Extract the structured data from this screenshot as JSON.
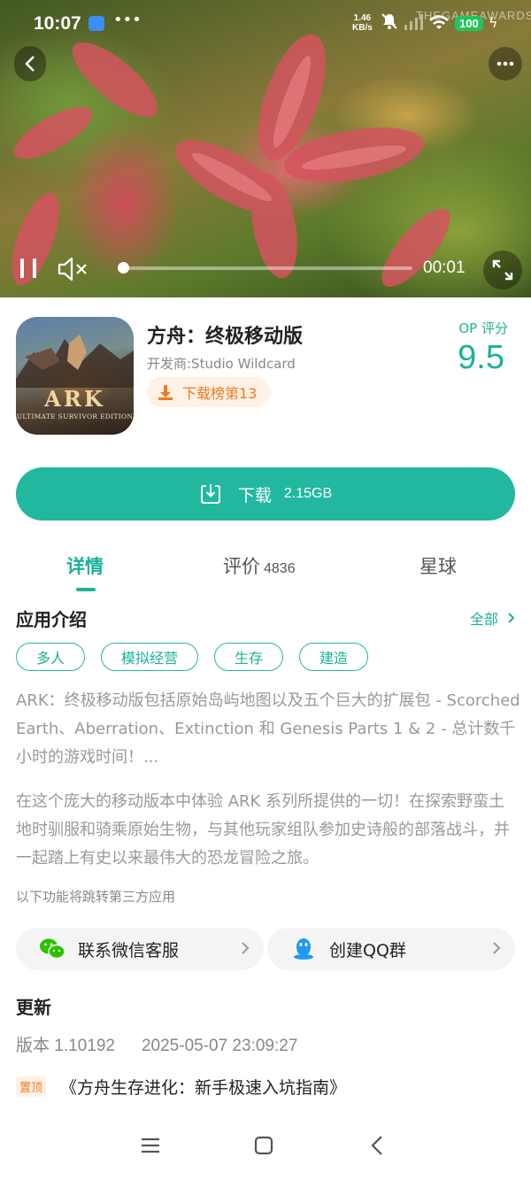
{
  "status_bar": {
    "time": "10:07",
    "net_speed_value": "1.46",
    "net_speed_unit": "KB/s",
    "battery": "100",
    "watermark": "THEGAMEAWARDS"
  },
  "video": {
    "elapsed": "00:01",
    "progress_fraction": 0.01
  },
  "app": {
    "name": "方舟：终极移动版",
    "developer": "开发商:Studio Wildcard",
    "rank_badge": "下载榜第13",
    "score_label": "OP 评分",
    "score_value": "9.5",
    "icon_logo_text": "ARK",
    "icon_subtitle": "ULTIMATE SURVIVOR EDITION"
  },
  "download": {
    "label": "下载",
    "size": "2.15GB"
  },
  "tabs": [
    {
      "label": "详情",
      "count": ""
    },
    {
      "label": "评价",
      "count": "4836"
    },
    {
      "label": "星球",
      "count": ""
    }
  ],
  "intro": {
    "title": "应用介绍",
    "see_all": "全部",
    "tags": [
      "多人",
      "模拟经营",
      "生存",
      "建造"
    ],
    "paragraph1": "ARK：终极移动版包括原始岛屿地图以及五个巨大的扩展包 - Scorched Earth、Aberration、Extinction 和 Genesis Parts 1 & 2 - 总计数千小时的游戏时间！...",
    "paragraph2": "在这个庞大的移动版本中体验 ARK 系列所提供的一切！在探索野蛮土地时驯服和骑乘原始生物，与其他玩家组队参加史诗般的部落战斗，并一起踏上有史以来最伟大的恐龙冒险之旅。",
    "third_party_note": "以下功能将跳转第三方应用"
  },
  "links": {
    "wechat": "联系微信客服",
    "qq": "创建QQ群"
  },
  "update": {
    "title": "更新",
    "version": "版本 1.10192",
    "date": "2025-05-07 23:09:27"
  },
  "pinned": {
    "badge": "置顶",
    "title": "《方舟生存进化：新手极速入坑指南》"
  },
  "colors": {
    "accent": "#22b8a0",
    "orange": "#ee7a1e",
    "wechat_green": "#2dc100",
    "qq_blue": "#1e9bf0"
  }
}
